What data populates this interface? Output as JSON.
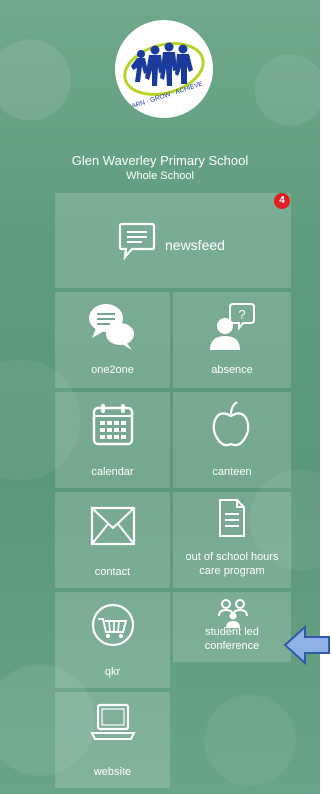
{
  "header": {
    "logo_text": "LEARN · GROW · ACHIEVE",
    "school_name": "Glen Waverley Primary School",
    "group": "Whole School"
  },
  "tiles": {
    "newsfeed": {
      "label": "newsfeed",
      "badge": "4",
      "icon": "newsfeed-icon"
    },
    "one2one": {
      "label": "one2one",
      "icon": "chat-bubbles-icon"
    },
    "absence": {
      "label": "absence",
      "icon": "person-question-icon"
    },
    "calendar": {
      "label": "calendar",
      "icon": "calendar-icon"
    },
    "canteen": {
      "label": "canteen",
      "icon": "apple-icon"
    },
    "contact": {
      "label": "contact",
      "icon": "envelope-icon"
    },
    "oshc": {
      "label_line1": "out of school hours",
      "label_line2": "care program",
      "icon": "document-icon"
    },
    "qkr": {
      "label": "qkr",
      "icon": "shopping-cart-icon"
    },
    "slc": {
      "label_line1": "student led",
      "label_line2": "conference",
      "icon": "people-icon"
    },
    "website": {
      "label": "website",
      "icon": "laptop-icon"
    }
  },
  "colors": {
    "background": "#5f9c7d",
    "badge": "#e02020",
    "arrow_fill": "#8fb2e6",
    "arrow_stroke": "#2f5aa8"
  }
}
